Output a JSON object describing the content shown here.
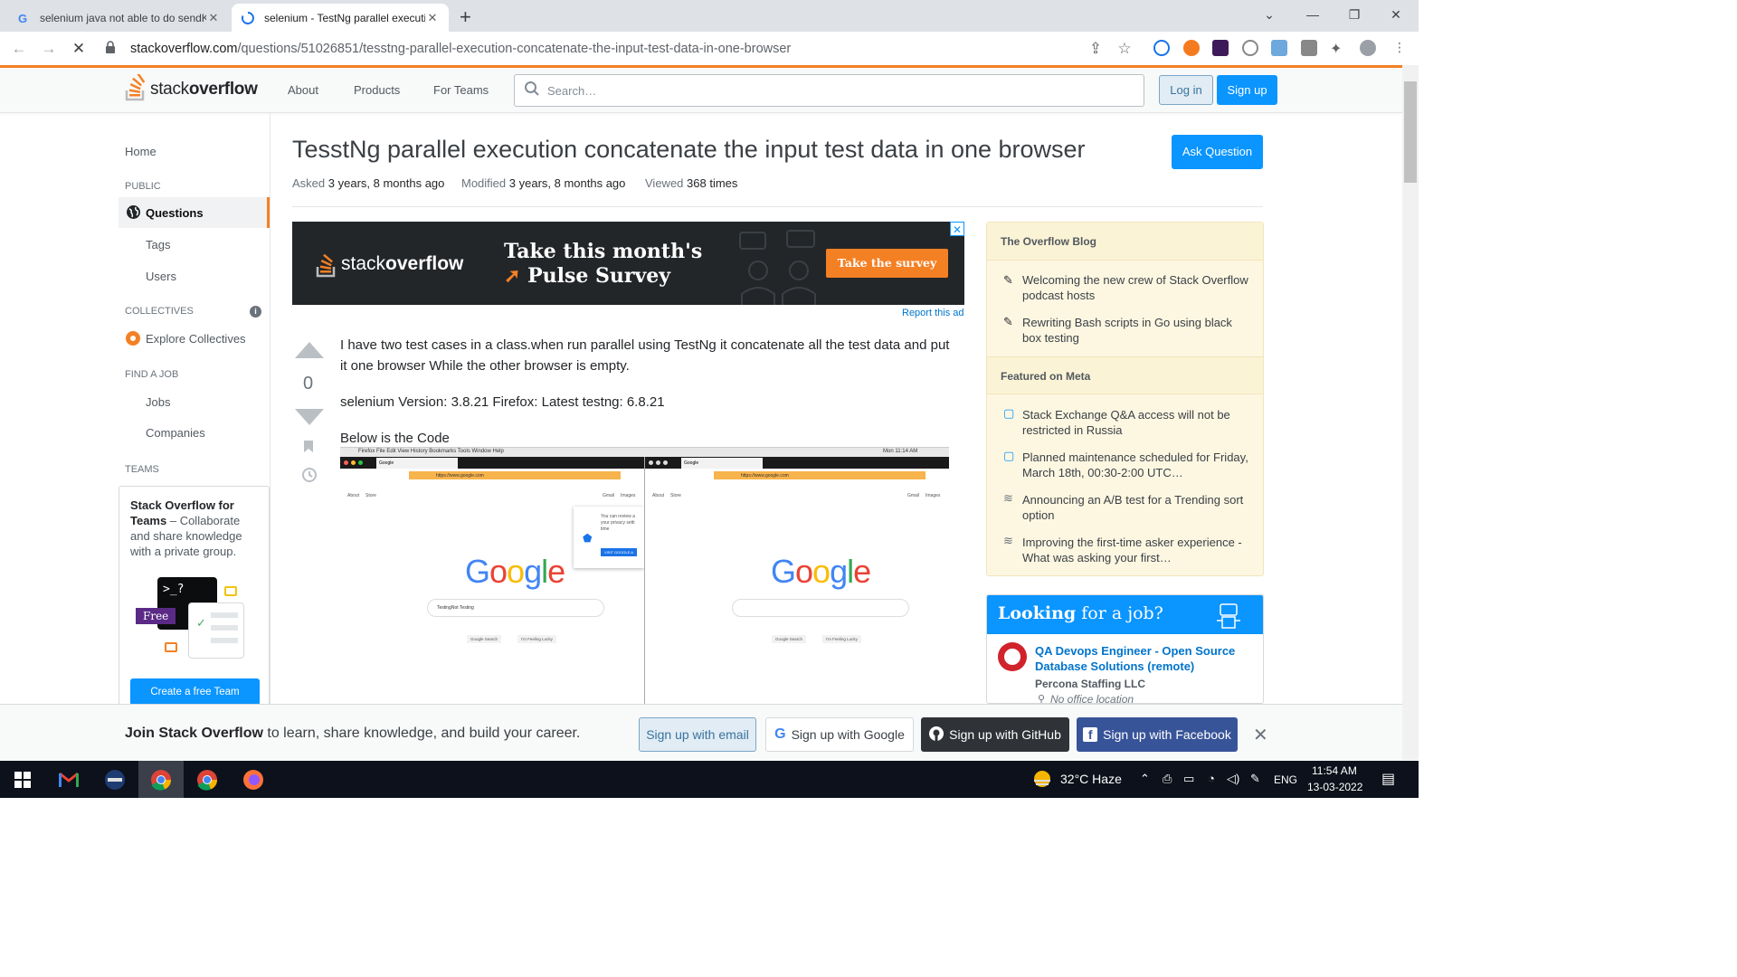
{
  "browser": {
    "tabs": [
      {
        "title": "selenium java not able to do sendKeys",
        "active": false
      },
      {
        "title": "selenium - TestNg parallel execution",
        "active": true
      }
    ],
    "new_tab": "+",
    "url_host": "stackoverflow.com",
    "url_path": "/questions/51026851/tesstng-parallel-execution-concatenate-the-input-test-data-in-one-browser"
  },
  "so_header": {
    "logo_light": "stack",
    "logo_bold": "overflow",
    "nav": [
      "About",
      "Products",
      "For Teams"
    ],
    "search_placeholder": "Search…",
    "login": "Log in",
    "signup": "Sign up"
  },
  "left_nav": {
    "home": "Home",
    "public": "PUBLIC",
    "questions": "Questions",
    "tags": "Tags",
    "users": "Users",
    "collectives": "COLLECTIVES",
    "explore": "Explore Collectives",
    "find_job": "FIND A JOB",
    "jobs": "Jobs",
    "companies": "Companies",
    "teams": "TEAMS",
    "teams_bold": "Stack Overflow for Teams",
    "teams_text": " – Collaborate and share knowledge with a private group.",
    "free_badge": "Free",
    "create_team": "Create a free Team"
  },
  "question": {
    "title": "TesstNg parallel execution concatenate the input test data in one browser",
    "asked_label": "Asked",
    "asked": "3 years, 8 months ago",
    "modified_label": "Modified",
    "modified": "3 years, 8 months ago",
    "viewed_label": "Viewed",
    "viewed": "368 times",
    "ask_button": "Ask Question",
    "votes": "0",
    "body_1": "I have two test cases in a class.when run parallel using TestNg it concatenate all the test data and put it one browser While the other browser is empty.",
    "body_2": "selenium Version: 3.8.21 Firefox: Latest testng: 6.8.21",
    "body_3": "Below is the Code"
  },
  "ad": {
    "logo_light": "stack",
    "logo_bold": "overflow",
    "line1": "Take this month's",
    "line2": "Pulse Survey",
    "cta": "Take the survey",
    "close": "✕",
    "report": "Report this ad"
  },
  "screenshot_text": {
    "google_word": "Google",
    "query": "TestingNot Testing",
    "search_btn": "Google Search",
    "lucky_btn": "I'm Feeling Lucky",
    "about": "About",
    "store": "Store",
    "gmail": "Gmail",
    "images": "Images",
    "url": "https://www.google.com",
    "tab_label": "Google",
    "menubar": "Firefox   File   Edit   View   History   Bookmarks   Tools   Window   Help",
    "clock": "Mon 11:14 AM",
    "privacy": "You can review a your privacy setti time",
    "visit": "VISIT GOOGLE A"
  },
  "sidebar": {
    "blog_header": "The Overflow Blog",
    "blog_items": [
      "Welcoming the new crew of Stack Overflow podcast hosts",
      "Rewriting Bash scripts in Go using black box testing"
    ],
    "meta_header": "Featured on Meta",
    "meta_items": [
      "Stack Exchange Q&A access will not be restricted in Russia",
      "Planned maintenance scheduled for Friday, March 18th, 00:30-2:00 UTC…",
      "Announcing an A/B test for a Trending sort option",
      "Improving the first-time asker experience - What was asking your first…"
    ],
    "jobs_header_bold": "Looking",
    "jobs_header_rest": " for a job?",
    "job_title": "QA Devops Engineer - Open Source Database Solutions (remote)",
    "job_company": "Percona Staffing LLC",
    "job_location": "No office location"
  },
  "join_banner": {
    "bold": "Join Stack Overflow",
    "rest": " to learn, share knowledge, and build your career.",
    "email": "Sign up with email",
    "google": "Sign up with Google",
    "github": "Sign up with GitHub",
    "facebook": "Sign up with Facebook",
    "close": "✕"
  },
  "taskbar": {
    "weather": "32°C  Haze",
    "lang": "ENG",
    "time": "11:54 AM",
    "date": "13-03-2022"
  }
}
